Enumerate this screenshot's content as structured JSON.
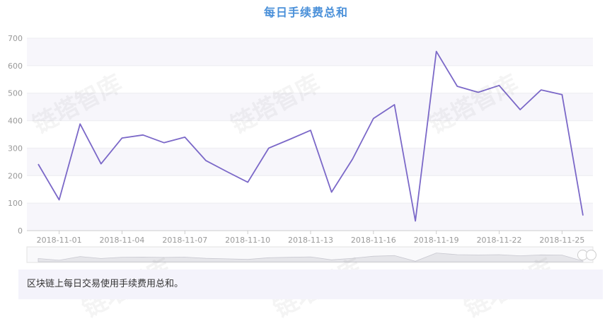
{
  "title": "每日手续费总和",
  "description": "区块链上每日交易使用手续费用总和。",
  "watermark": "链塔智库",
  "colors": {
    "line": "#7b68c8",
    "title": "#4a90d9",
    "band": "#f7f6fb"
  },
  "chart_data": {
    "type": "line",
    "title": "每日手续费总和",
    "xlabel": "",
    "ylabel": "",
    "ylim": [
      0,
      700
    ],
    "yticks": [
      0,
      100,
      200,
      300,
      400,
      500,
      600,
      700
    ],
    "x_tick_labels": [
      "2018-11-01",
      "2018-11-04",
      "2018-11-07",
      "2018-11-10",
      "2018-11-13",
      "2018-11-16",
      "2018-11-19",
      "2018-11-22",
      "2018-11-25"
    ],
    "x": [
      "2018-10-31",
      "2018-11-01",
      "2018-11-02",
      "2018-11-03",
      "2018-11-04",
      "2018-11-05",
      "2018-11-06",
      "2018-11-07",
      "2018-11-08",
      "2018-11-09",
      "2018-11-10",
      "2018-11-11",
      "2018-11-12",
      "2018-11-13",
      "2018-11-14",
      "2018-11-15",
      "2018-11-16",
      "2018-11-17",
      "2018-11-18",
      "2018-11-19",
      "2018-11-20",
      "2018-11-21",
      "2018-11-22",
      "2018-11-23",
      "2018-11-24",
      "2018-11-25",
      "2018-11-26"
    ],
    "values": [
      242,
      112,
      388,
      243,
      337,
      348,
      320,
      340,
      255,
      215,
      176,
      300,
      332,
      365,
      140,
      260,
      408,
      458,
      35,
      652,
      525,
      503,
      528,
      440,
      512,
      495,
      55
    ],
    "grid": true,
    "legend": "none"
  }
}
